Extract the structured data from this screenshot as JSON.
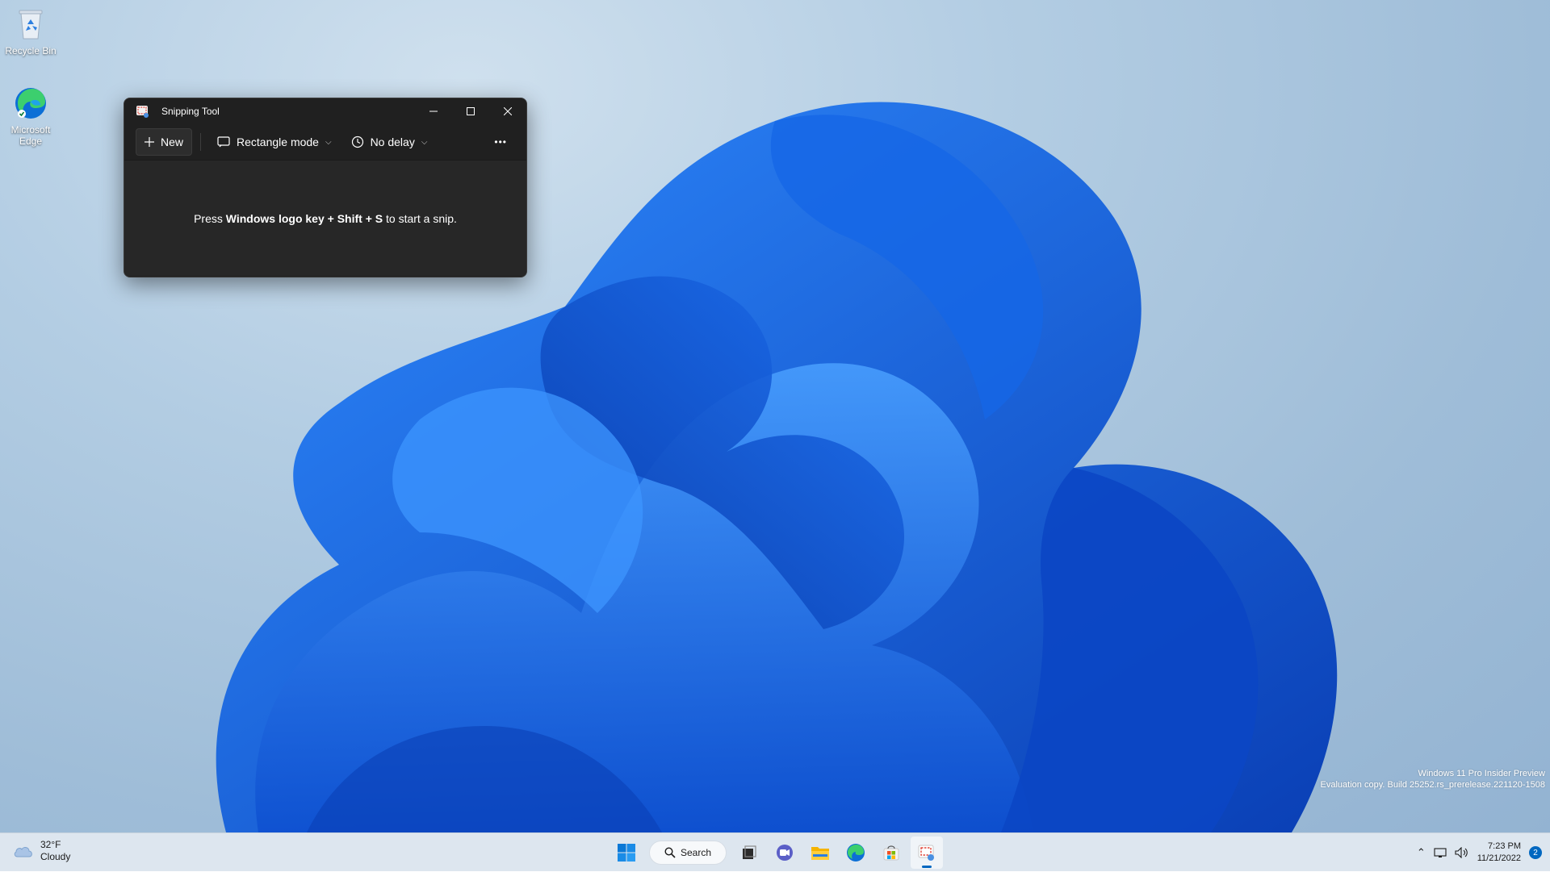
{
  "desktop": {
    "icons": [
      {
        "label": "Recycle Bin",
        "icon": "recycle-bin-icon"
      },
      {
        "label": "Microsoft Edge",
        "icon": "edge-icon"
      }
    ],
    "watermark": {
      "line1": "Windows 11 Pro Insider Preview",
      "line2": "Evaluation copy. Build 25252.rs_prerelease.221120-1508"
    }
  },
  "window": {
    "title": "Snipping Tool",
    "toolbar": {
      "new_label": "New",
      "mode_label": "Rectangle mode",
      "delay_label": "No delay",
      "more_label": "•••"
    },
    "hint": {
      "prefix": "Press ",
      "keys": "Windows logo key + Shift + S",
      "suffix": " to start a snip."
    }
  },
  "taskbar": {
    "weather": {
      "temp": "32°F",
      "condition": "Cloudy"
    },
    "search_label": "Search",
    "pinned": [
      "start-icon",
      "task-view-icon",
      "chat-icon",
      "file-explorer-icon",
      "edge-icon",
      "store-icon",
      "snipping-tool-icon"
    ],
    "clock": {
      "time": "7:23 PM",
      "date": "11/21/2022"
    },
    "notification_count": "2"
  },
  "colors": {
    "accent": "#0067c0",
    "window_bg": "#202020",
    "taskbar_bg": "#dde6ef"
  }
}
